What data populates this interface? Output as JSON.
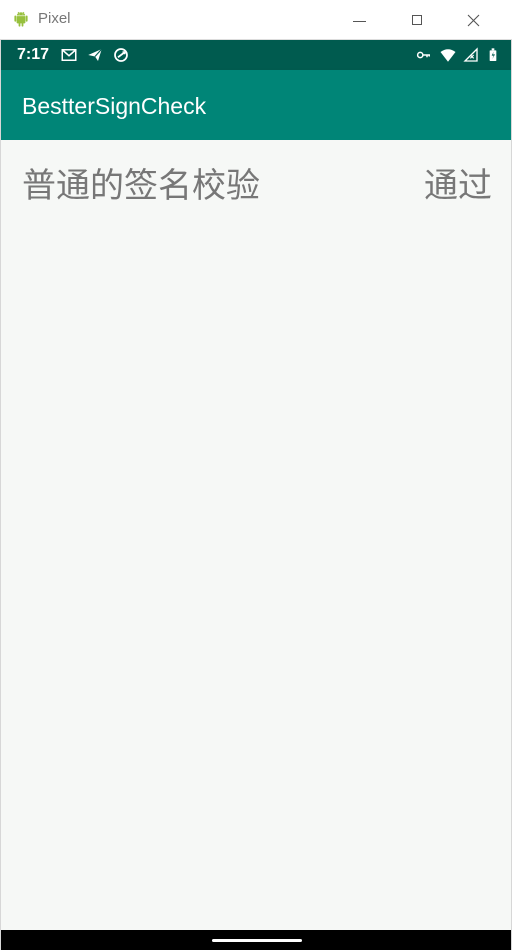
{
  "window": {
    "title": "Pixel",
    "icons": {
      "app": "android-icon",
      "minimize": "minimize-icon",
      "maximize": "maximize-icon",
      "close": "close-icon"
    }
  },
  "status_bar": {
    "time": "7:17",
    "left_icons": [
      "gmail-icon",
      "send-icon",
      "sync-icon"
    ],
    "right_icons": [
      "key-icon",
      "wifi-icon",
      "signal-icon",
      "battery-icon"
    ]
  },
  "app_bar": {
    "title": "BestterSignCheck"
  },
  "main": {
    "check": {
      "label": "普通的签名校验",
      "result": "通过"
    }
  },
  "colors": {
    "status_bar": "#005b4f",
    "app_bar": "#008577",
    "background": "#f6f8f6",
    "text": "#777777",
    "android_green": "#97c03d"
  }
}
